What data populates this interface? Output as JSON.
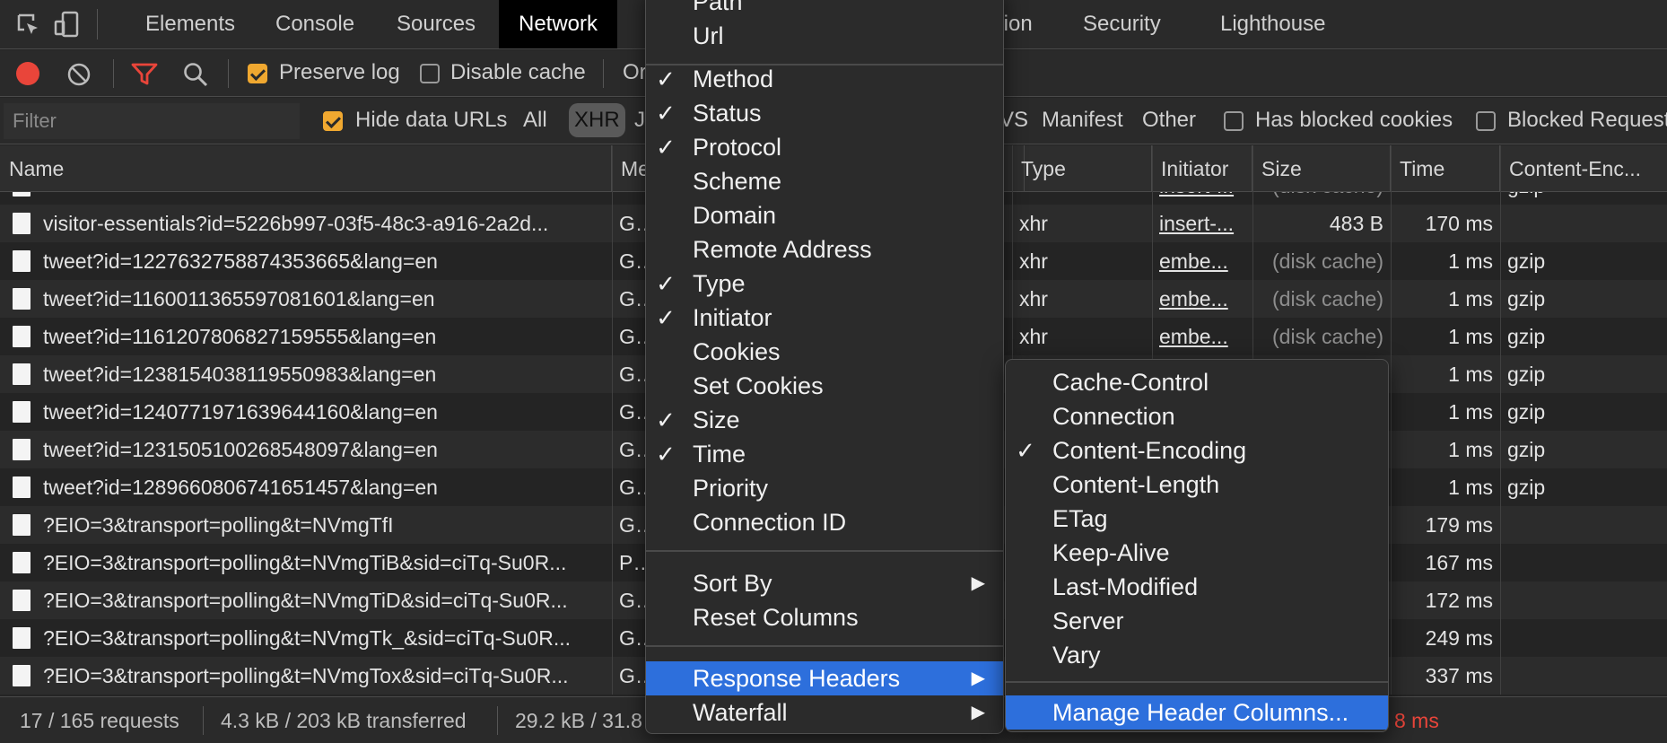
{
  "tabs": {
    "items": [
      "Elements",
      "Console",
      "Sources",
      "Network",
      "tion",
      "Security",
      "Lighthouse"
    ],
    "active": "Network"
  },
  "toolbar": {
    "preserve_log": "Preserve log",
    "disable_cache": "Disable cache",
    "online_partial": "Or"
  },
  "filterbar": {
    "placeholder": "Filter",
    "hide_data_urls": "Hide data URLs",
    "all": "All",
    "xhr": "XHR",
    "js_partial": "J",
    "ws_partial": "VS",
    "manifest": "Manifest",
    "other": "Other",
    "has_blocked_cookies": "Has blocked cookies",
    "blocked_requests": "Blocked Requests"
  },
  "table": {
    "headers": {
      "name": "Name",
      "method": "Me",
      "type": "Type",
      "initiator": "Initiator",
      "size": "Size",
      "time": "Time",
      "content_encoding": "Content-Enc..."
    },
    "partial_top": {
      "initiator": "insert-...",
      "size": "(disk cache)",
      "encoding": "gzip"
    },
    "rows": [
      {
        "name": "visitor-essentials?id=5226b997-03f5-48c3-a916-2a2d...",
        "method": "GE",
        "type": "xhr",
        "initiator": "insert-...",
        "size": "483 B",
        "time": "170 ms",
        "encoding": ""
      },
      {
        "name": "tweet?id=1227632758874353665&lang=en",
        "method": "GE",
        "type": "xhr",
        "initiator": "embe...",
        "size": "(disk cache)",
        "time": "1 ms",
        "encoding": "gzip"
      },
      {
        "name": "tweet?id=1160011365597081601&lang=en",
        "method": "GE",
        "type": "xhr",
        "initiator": "embe...",
        "size": "(disk cache)",
        "time": "1 ms",
        "encoding": "gzip"
      },
      {
        "name": "tweet?id=1161207806827159555&lang=en",
        "method": "GE",
        "type": "xhr",
        "initiator": "embe...",
        "size": "(disk cache)",
        "time": "1 ms",
        "encoding": "gzip"
      },
      {
        "name": "tweet?id=1238154038119550983&lang=en",
        "method": "GE",
        "type": "",
        "initiator": "",
        "size": "",
        "time": "1 ms",
        "encoding": "gzip"
      },
      {
        "name": "tweet?id=1240771971639644160&lang=en",
        "method": "GE",
        "type": "",
        "initiator": "",
        "size": "",
        "time": "1 ms",
        "encoding": "gzip"
      },
      {
        "name": "tweet?id=1231505100268548097&lang=en",
        "method": "GE",
        "type": "",
        "initiator": "",
        "size": "",
        "time": "1 ms",
        "encoding": "gzip"
      },
      {
        "name": "tweet?id=1289660806741651457&lang=en",
        "method": "GE",
        "type": "",
        "initiator": "",
        "size": "",
        "time": "1 ms",
        "encoding": "gzip"
      },
      {
        "name": "?EIO=3&transport=polling&t=NVmgTfI",
        "method": "GE",
        "type": "",
        "initiator": "",
        "size": "",
        "time": "179 ms",
        "encoding": ""
      },
      {
        "name": "?EIO=3&transport=polling&t=NVmgTiB&sid=ciTq-Su0R...",
        "method": "PO",
        "type": "",
        "initiator": "",
        "size": "",
        "time": "167 ms",
        "encoding": ""
      },
      {
        "name": "?EIO=3&transport=polling&t=NVmgTiD&sid=ciTq-Su0R...",
        "method": "GE",
        "type": "",
        "initiator": "",
        "size": "",
        "time": "172 ms",
        "encoding": ""
      },
      {
        "name": "?EIO=3&transport=polling&t=NVmgTk_&sid=ciTq-Su0R...",
        "method": "GE",
        "type": "",
        "initiator": "",
        "size": "",
        "time": "249 ms",
        "encoding": ""
      },
      {
        "name": "?EIO=3&transport=polling&t=NVmgTox&sid=ciTq-Su0R...",
        "method": "GE",
        "type": "",
        "initiator": "",
        "size": "",
        "time": "337 ms",
        "encoding": ""
      }
    ]
  },
  "statusbar": {
    "requests": "17 / 165 requests",
    "transferred": "4.3 kB / 203 kB transferred",
    "resources": "29.2 kB / 31.8",
    "load_partial": "8 ms"
  },
  "context_menu": {
    "top_items": [
      {
        "label": "Path",
        "checked": false
      },
      {
        "label": "Url",
        "checked": false
      }
    ],
    "column_items": [
      {
        "label": "Method",
        "checked": true
      },
      {
        "label": "Status",
        "checked": true
      },
      {
        "label": "Protocol",
        "checked": true
      },
      {
        "label": "Scheme",
        "checked": false
      },
      {
        "label": "Domain",
        "checked": false
      },
      {
        "label": "Remote Address",
        "checked": false
      },
      {
        "label": "Type",
        "checked": true
      },
      {
        "label": "Initiator",
        "checked": true
      },
      {
        "label": "Cookies",
        "checked": false
      },
      {
        "label": "Set Cookies",
        "checked": false
      },
      {
        "label": "Size",
        "checked": true
      },
      {
        "label": "Time",
        "checked": true
      },
      {
        "label": "Priority",
        "checked": false
      },
      {
        "label": "Connection ID",
        "checked": false
      }
    ],
    "sort_by": "Sort By",
    "reset_columns": "Reset Columns",
    "response_headers": "Response Headers",
    "waterfall": "Waterfall",
    "check_glyph": "✓",
    "arrow_glyph": "▶"
  },
  "submenu": {
    "items": [
      {
        "label": "Cache-Control",
        "checked": false
      },
      {
        "label": "Connection",
        "checked": false
      },
      {
        "label": "Content-Encoding",
        "checked": true
      },
      {
        "label": "Content-Length",
        "checked": false
      },
      {
        "label": "ETag",
        "checked": false
      },
      {
        "label": "Keep-Alive",
        "checked": false
      },
      {
        "label": "Last-Modified",
        "checked": false
      },
      {
        "label": "Server",
        "checked": false
      },
      {
        "label": "Vary",
        "checked": false
      }
    ],
    "manage": "Manage Header Columns..."
  },
  "colors": {
    "record": "#e9453a",
    "filter_active": "#e9453a",
    "checkbox_on": "#f0a830",
    "menu_highlight": "#2d6fdc",
    "tab_active_bg": "#000000"
  }
}
